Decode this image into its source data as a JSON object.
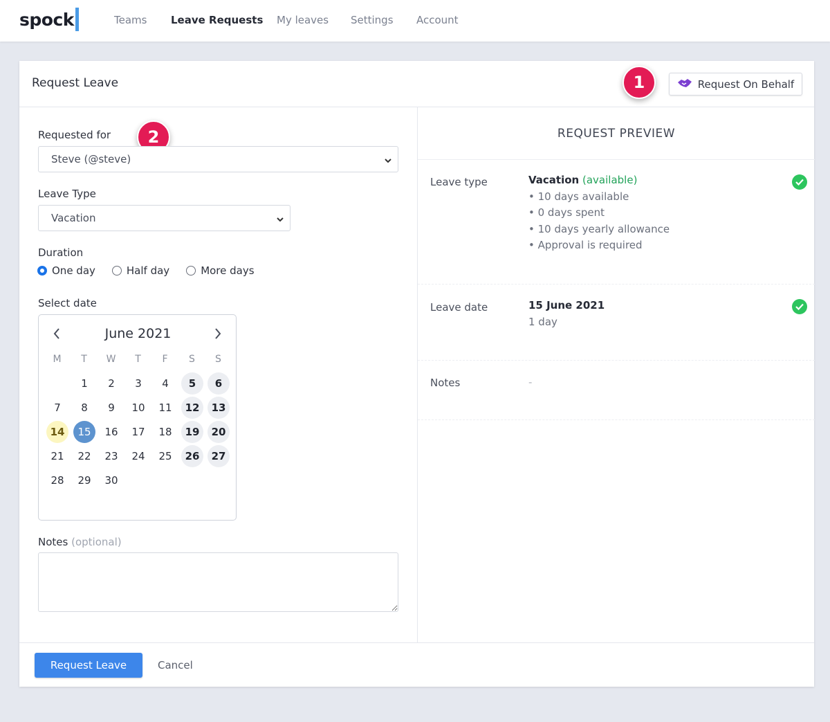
{
  "brand": {
    "logo_text": "spock"
  },
  "nav": {
    "items": [
      {
        "label": "Teams",
        "active": false
      },
      {
        "label": "Leave Requests",
        "active": true
      },
      {
        "label": "My leaves",
        "active": false
      },
      {
        "label": "Settings",
        "active": false
      },
      {
        "label": "Account",
        "active": false
      }
    ]
  },
  "card": {
    "title": "Request Leave",
    "behalf_button": "Request On Behalf",
    "badges": [
      "1",
      "2"
    ]
  },
  "form": {
    "requested_for_label": "Requested for",
    "requested_for_value": "Steve (@steve)",
    "leave_type_label": "Leave Type",
    "leave_type_value": "Vacation",
    "duration_label": "Duration",
    "duration_options": [
      {
        "label": "One day",
        "checked": true
      },
      {
        "label": "Half day",
        "checked": false
      },
      {
        "label": "More days",
        "checked": false
      }
    ],
    "select_date_label": "Select date",
    "notes_label": "Notes",
    "notes_optional": "(optional)",
    "notes_value": ""
  },
  "calendar": {
    "title": "June 2021",
    "weekdays": [
      "M",
      "T",
      "W",
      "T",
      "F",
      "S",
      "S"
    ],
    "first_weekday_index": 1,
    "days_in_month": 30,
    "today": 14,
    "selected": 15
  },
  "footer": {
    "submit_label": "Request Leave",
    "cancel_label": "Cancel"
  },
  "preview": {
    "title": "REQUEST PREVIEW",
    "leave_type_label": "Leave type",
    "leave_type_name": "Vacation",
    "leave_type_status": "(available)",
    "leave_type_details": [
      "• 10 days available",
      "• 0 days spent",
      "• 10 days yearly allowance",
      "• Approval is required"
    ],
    "leave_date_label": "Leave date",
    "leave_date_value": "15 June 2021",
    "leave_date_duration": "1 day",
    "notes_label": "Notes",
    "notes_value": "-"
  },
  "colors": {
    "primary": "#3d86ea",
    "badge": "#e31b55",
    "success": "#2dc55e",
    "logo_bar": "#4a9be6"
  }
}
